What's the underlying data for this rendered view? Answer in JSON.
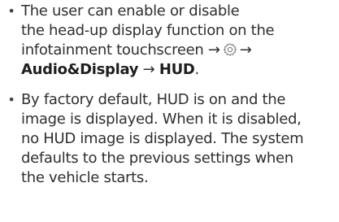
{
  "bullets": [
    {
      "line1": "The user can enable or disable",
      "line2": "the head-up display function on the",
      "line3_pre": "infotainment touchscreen →",
      "line3_post": "→",
      "icon": "gear-icon",
      "nav_item1": "Audio&Display",
      "arrow": "→",
      "nav_item2": "HUD",
      "period": "."
    },
    {
      "lines": [
        "By factory default, HUD is on and the",
        "image is displayed. When it is disabled,",
        "no HUD image is displayed. The system",
        "defaults to the previous settings when",
        "the vehicle starts."
      ]
    }
  ]
}
